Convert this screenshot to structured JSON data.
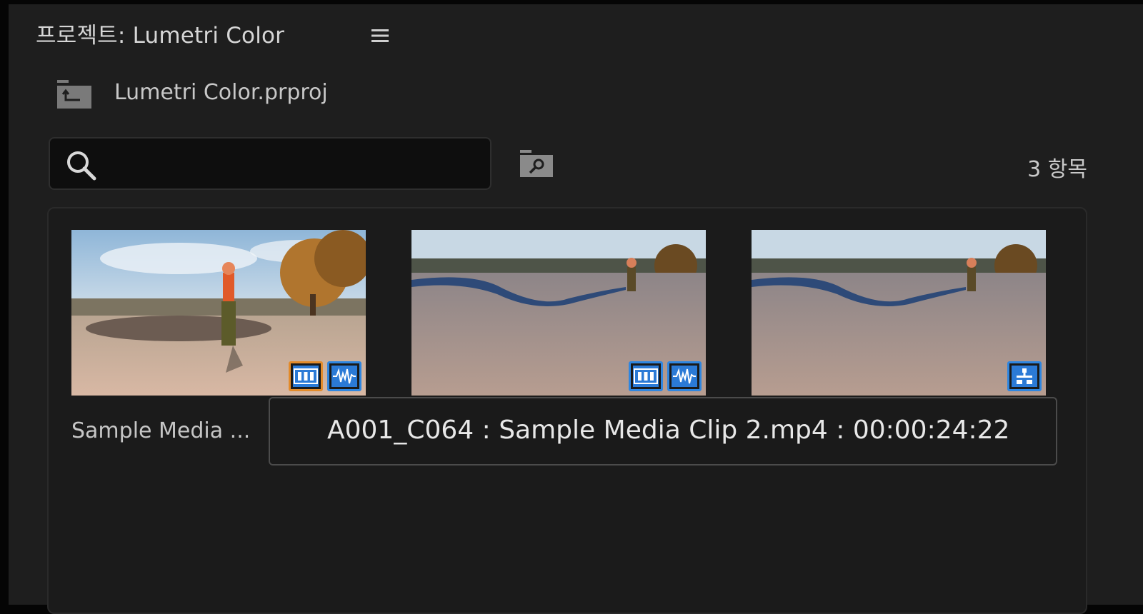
{
  "panel": {
    "title": "프로젝트: Lumetri Color",
    "menu_icon": "hamburger-menu-icon"
  },
  "project": {
    "file_name": "Lumetri Color.prproj",
    "icon": "folder-up-icon"
  },
  "search": {
    "value": "",
    "placeholder": "",
    "icon": "search-icon"
  },
  "toolbar": {
    "bin_search_icon": "folder-search-icon",
    "item_count": "3 항목"
  },
  "clips": [
    {
      "name": "Sample Media ...",
      "badges": [
        "video-icon",
        "audio-icon"
      ],
      "selected_badge": "video-icon"
    },
    {
      "name": "",
      "badges": [
        "video-icon",
        "audio-icon"
      ]
    },
    {
      "name": "",
      "badges": [
        "sequence-icon"
      ]
    }
  ],
  "tooltip": {
    "text": "A001_C064 : Sample Media Clip 2.mp4 : 00:00:24:22"
  },
  "colors": {
    "badge_blue": "#2f86e0",
    "selected_orange": "#e38b2a",
    "panel_bg": "#1e1e1e"
  }
}
